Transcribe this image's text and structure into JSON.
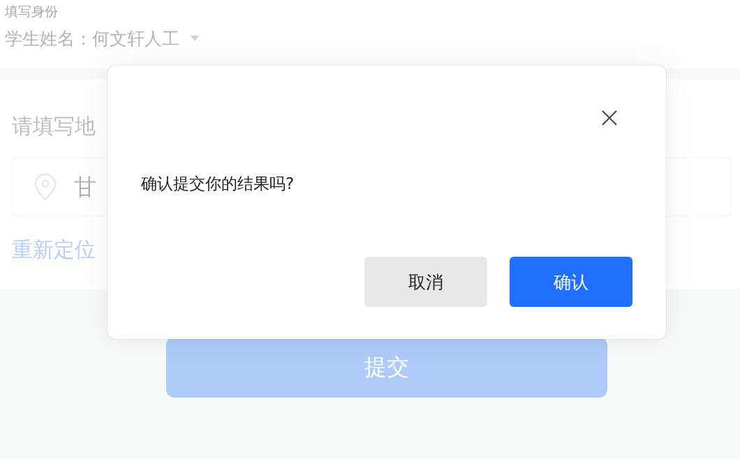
{
  "header": {
    "section_title": "填写身份",
    "student_label": "学生姓名：",
    "student_value": "何文轩人工"
  },
  "address": {
    "title": "请填写地",
    "field_value": "甘",
    "relocate_link": "重新定位"
  },
  "submit_button": "提交",
  "dialog": {
    "message": "确认提交你的结果吗?",
    "buttons": [
      {
        "label": "取消",
        "kind": "secondary"
      },
      {
        "label": "确认",
        "kind": "primary"
      }
    ]
  }
}
